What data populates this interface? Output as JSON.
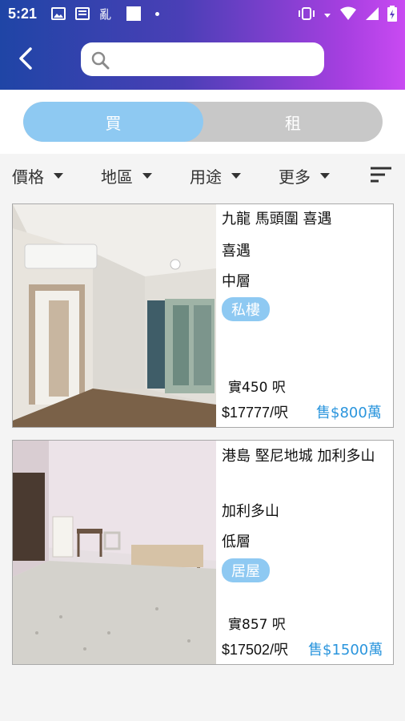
{
  "status_bar": {
    "time": "5:21"
  },
  "search": {
    "placeholder": "",
    "value": ""
  },
  "segment": {
    "buy_label": "買",
    "rent_label": "租"
  },
  "filters": [
    {
      "label": "價格"
    },
    {
      "label": "地區"
    },
    {
      "label": "用途"
    },
    {
      "label": "更多"
    }
  ],
  "listings": [
    {
      "district": "九龍 馬頭圍 喜遇",
      "estate": "喜遇",
      "floor": "中層",
      "tag": "私樓",
      "area": "實450 呎",
      "unit_price": "$17777/呎",
      "sale_price": "售$800萬"
    },
    {
      "district": "港島 堅尼地城 加利多山",
      "estate": "加利多山",
      "floor": "低層",
      "tag": "居屋",
      "area": "實857 呎",
      "unit_price": "$17502/呎",
      "sale_price": "售$1500萬"
    }
  ],
  "colors": {
    "accent_blue": "#8ec9f2",
    "price_blue": "#2a95dd",
    "header_start": "#1f45a6",
    "header_end": "#c94af2"
  },
  "icons": [
    "back-arrow-icon",
    "search-icon",
    "caret-down-icon",
    "sort-icon",
    "wifi-icon",
    "signal-icon",
    "battery-icon",
    "vibrate-icon"
  ]
}
